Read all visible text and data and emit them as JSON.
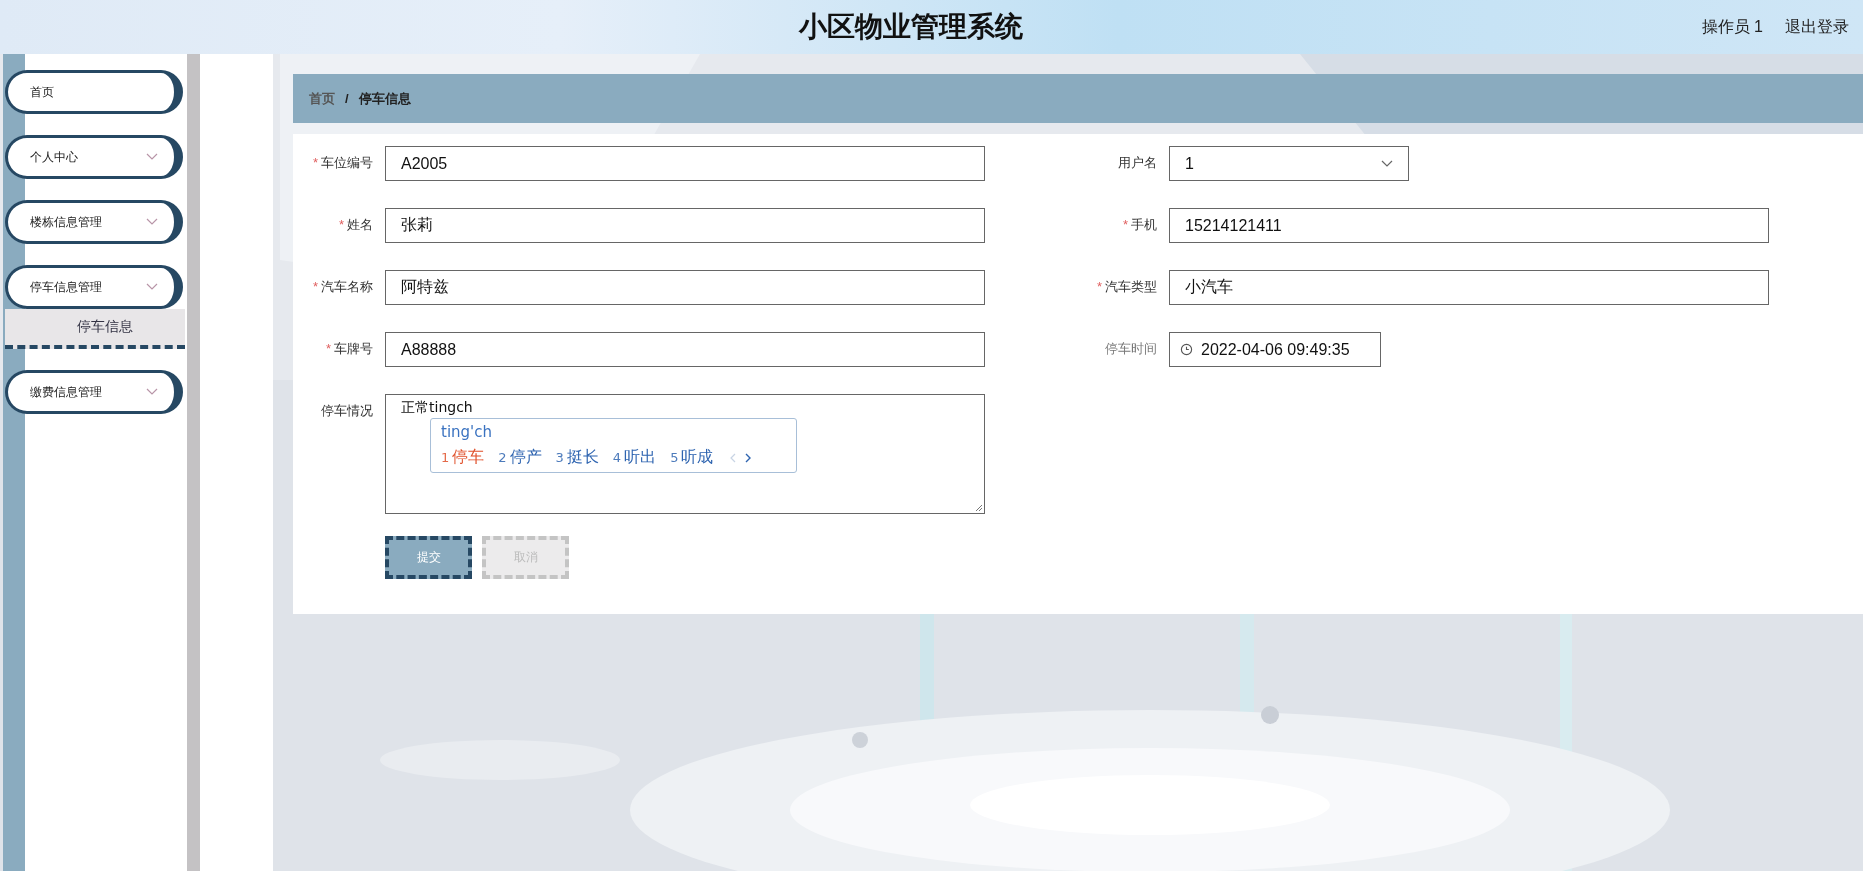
{
  "header": {
    "title": "小区物业管理系统",
    "user": "操作员 1",
    "logout": "退出登录"
  },
  "sidebar": {
    "items": [
      {
        "label": "首页",
        "kind": "link"
      },
      {
        "label": "个人中心",
        "kind": "submenu"
      },
      {
        "label": "楼栋信息管理",
        "kind": "submenu"
      },
      {
        "label": "停车信息管理",
        "kind": "submenu",
        "children": [
          {
            "label": "停车信息",
            "selected": true
          }
        ]
      },
      {
        "label": "缴费信息管理",
        "kind": "submenu"
      }
    ]
  },
  "breadcrumb": {
    "items": [
      "首页",
      "停车信息"
    ],
    "separator": "/"
  },
  "form": {
    "rows": [
      {
        "fields": [
          {
            "label": "车位编号",
            "required_mark": "*",
            "kind": "text",
            "value": "A2005"
          },
          {
            "label": "用户名",
            "kind": "select",
            "value": "1"
          }
        ]
      },
      {
        "fields": [
          {
            "label": "姓名",
            "required_mark": "*",
            "kind": "text",
            "value": "张莉"
          },
          {
            "label": "手机",
            "required_mark": "*",
            "kind": "text",
            "value": "15214121411"
          }
        ]
      },
      {
        "fields": [
          {
            "label": "汽车名称",
            "required_mark": "*",
            "kind": "text",
            "value": "阿特兹"
          },
          {
            "label": "汽车类型",
            "required_mark": "*",
            "kind": "text",
            "value": "小汽车"
          }
        ]
      },
      {
        "fields": [
          {
            "label": "车牌号",
            "required_mark": "*",
            "kind": "text",
            "value": "A88888"
          },
          {
            "label": "停车时间",
            "kind": "datetime",
            "value": "2022-04-06 09:49:35"
          }
        ]
      },
      {
        "fields": [
          {
            "label": "停车情况",
            "kind": "textarea",
            "value": "正常tingch"
          }
        ]
      }
    ],
    "buttons": [
      {
        "label": "提交",
        "kind": "primary"
      },
      {
        "label": "取消",
        "kind": "secondary"
      }
    ]
  },
  "ime": {
    "composition": "ting'ch",
    "candidates": [
      {
        "index": "1",
        "text": "停车",
        "selected": true
      },
      {
        "index": "2",
        "text": "停产",
        "selected": false
      },
      {
        "index": "3",
        "text": "挺长",
        "selected": false
      },
      {
        "index": "4",
        "text": "听出",
        "selected": false
      },
      {
        "index": "5",
        "text": "听成",
        "selected": false
      }
    ]
  }
}
